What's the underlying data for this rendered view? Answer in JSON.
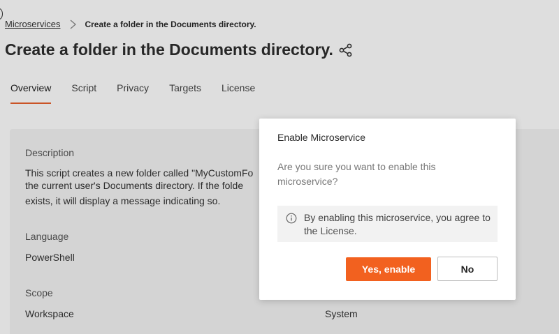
{
  "breadcrumb": {
    "parent": "Microservices",
    "current": "Create a folder in the Documents directory."
  },
  "page": {
    "title": "Create a folder in the Documents directory."
  },
  "tabs": [
    {
      "label": "Overview",
      "active": true
    },
    {
      "label": "Script",
      "active": false
    },
    {
      "label": "Privacy",
      "active": false
    },
    {
      "label": "Targets",
      "active": false
    },
    {
      "label": "License",
      "active": false
    }
  ],
  "details": {
    "description_label": "Description",
    "description_lines": [
      "This script creates a new folder called \"MyCustomFo",
      "the current user's Documents directory. If the folde",
      "exists, it will display a message indicating so."
    ],
    "language_label": "Language",
    "language_value": "PowerShell",
    "scope_label": "Scope",
    "scope_value": "Workspace",
    "right_scope_value": "System"
  },
  "modal": {
    "title": "Enable Microservice",
    "message": "Are you sure you want to enable this microservice?",
    "notice_text": "By enabling this microservice, you agree to the",
    "notice_link": "License.",
    "confirm_label": "Yes, enable",
    "cancel_label": "No"
  },
  "colors": {
    "accent": "#f2611f",
    "tab_underline": "#e8612c"
  }
}
